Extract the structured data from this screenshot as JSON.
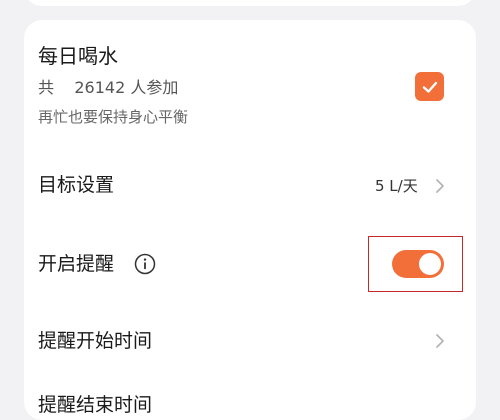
{
  "habit": {
    "title": "每日喝水",
    "count_text": "共    26142 人参加",
    "description": "再忙也要保持身心平衡",
    "checked": true,
    "checkbox_icon": "checkmark-icon"
  },
  "settings": {
    "goal": {
      "label": "目标设置",
      "value": "5 L/天",
      "icon": "chevron-right-icon"
    },
    "reminder": {
      "label": "开启提醒",
      "info_icon": "info-icon",
      "enabled": true
    },
    "start_time": {
      "label": "提醒开始时间",
      "icon": "chevron-right-icon"
    },
    "end_time": {
      "label": "提醒结束时间"
    }
  },
  "colors": {
    "accent": "#f26f3a",
    "highlight": "#c62828",
    "card": "#ffffff",
    "background": "#f2f2f4"
  }
}
